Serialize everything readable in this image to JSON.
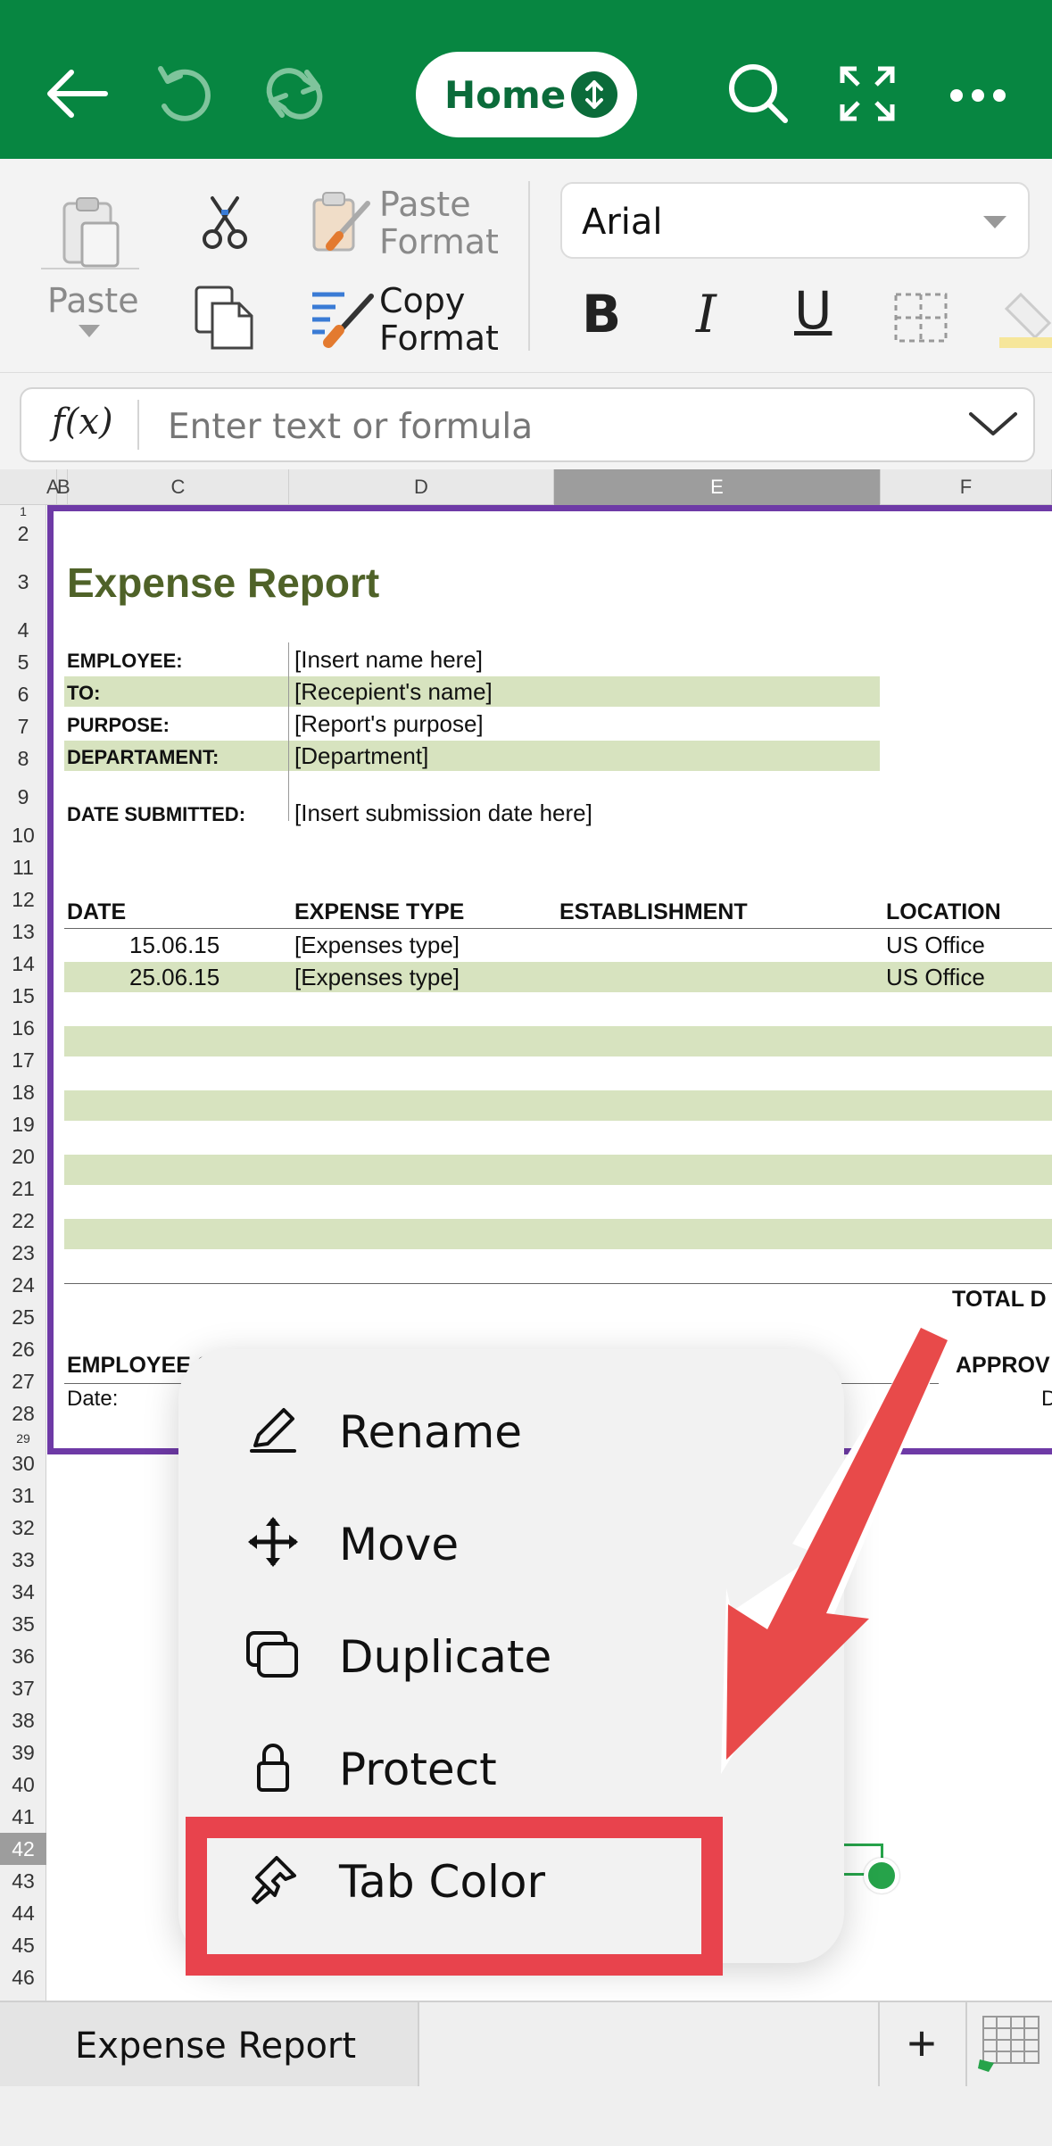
{
  "topbar": {
    "home_label": "Home",
    "bg_color": "#078641",
    "icons": [
      "back-arrow-icon",
      "undo-icon",
      "redo-icon",
      "search-icon",
      "fullscreen-icon",
      "more-icon"
    ]
  },
  "ribbon": {
    "paste_label": "Paste",
    "paste_format_line1": "Paste",
    "paste_format_line2": "Format",
    "copy_format_line1": "Copy",
    "copy_format_line2": "Format",
    "font_name": "Arial",
    "bold": "B",
    "italic": "I",
    "underline": "U"
  },
  "formula_bar": {
    "fx_label": "f(x)",
    "placeholder": "Enter text or formula"
  },
  "columns": [
    "A",
    "B",
    "C",
    "D",
    "E",
    "F"
  ],
  "selected_column": "E",
  "rows": [
    "1",
    "2",
    "3",
    "4",
    "5",
    "6",
    "7",
    "8",
    "9",
    "10",
    "11",
    "12",
    "13",
    "14",
    "15",
    "16",
    "17",
    "18",
    "19",
    "20",
    "21",
    "22",
    "23",
    "24",
    "25",
    "26",
    "27",
    "28",
    "29",
    "30",
    "31",
    "32",
    "33",
    "34",
    "35",
    "36",
    "37",
    "38",
    "39",
    "40",
    "41",
    "42",
    "43",
    "44",
    "45",
    "46"
  ],
  "selected_row": "42",
  "sheet": {
    "title": "Expense Report",
    "fields": [
      {
        "label": "EMPLOYEE:",
        "value": "[Insert name here]"
      },
      {
        "label": "TO:",
        "value": "[Recepient's name]"
      },
      {
        "label": "PURPOSE:",
        "value": "[Report's purpose]"
      },
      {
        "label": "DEPARTAMENT:",
        "value": "[Department]"
      },
      {
        "label": "DATE SUBMITTED:",
        "value": "[Insert submission date here]"
      }
    ],
    "table_headers": [
      "DATE",
      "EXPENSE TYPE",
      "ESTABLISHMENT",
      "LOCATION"
    ],
    "table_rows": [
      {
        "date": "15.06.15",
        "type": "[Expenses type]",
        "location": "US Office"
      },
      {
        "date": "25.06.15",
        "type": "[Expenses type]",
        "location": "US Office"
      }
    ],
    "total_label": "TOTAL D",
    "employee_sig": "EMPLOYEE S",
    "approval_label": "APPROV",
    "date_label": "Date:",
    "date_right": "D"
  },
  "context_menu": {
    "items": [
      {
        "label": "Rename",
        "icon": "pencil-icon"
      },
      {
        "label": "Move",
        "icon": "move-arrows-icon"
      },
      {
        "label": "Duplicate",
        "icon": "duplicate-icon"
      },
      {
        "label": "Protect",
        "icon": "lock-icon"
      },
      {
        "label": "Tab Color",
        "icon": "paintbrush-icon"
      }
    ]
  },
  "tabs": {
    "active_sheet": "Expense Report",
    "add_label": "+"
  },
  "colors": {
    "band": "#d7e3bf",
    "title": "#4f6228",
    "frame": "#6e3aa6",
    "highlight": "#e8434d"
  }
}
